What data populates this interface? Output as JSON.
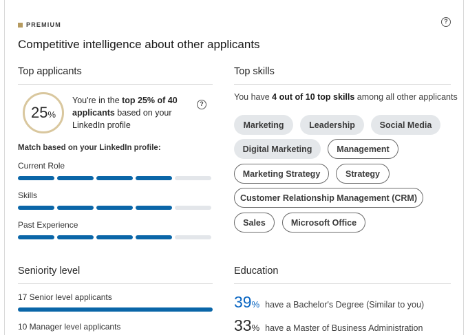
{
  "premium": {
    "label": "PREMIUM",
    "accent_color": "#b69b60"
  },
  "title": "Competitive intelligence about other applicants",
  "top_applicants": {
    "heading": "Top applicants",
    "percent_number": "25",
    "percent_sign": "%",
    "rank_prefix": "You're in the ",
    "rank_bold": "top 25% of 40 applicants",
    "rank_suffix": " based on your LinkedIn profile",
    "match_heading": "Match based on your LinkedIn profile:",
    "metrics": [
      {
        "label": "Current Role",
        "filled_segments": 4,
        "total_segments": 5
      },
      {
        "label": "Skills",
        "filled_segments": 4,
        "total_segments": 5
      },
      {
        "label": "Past Experience",
        "filled_segments": 4,
        "total_segments": 5
      }
    ],
    "bar_color": "#0a66a8"
  },
  "top_skills": {
    "heading": "Top skills",
    "intro_prefix": "You have ",
    "intro_bold": "4 out of 10 top skills",
    "intro_suffix": " among all other applicants",
    "skills": [
      {
        "label": "Marketing",
        "matched": true
      },
      {
        "label": "Leadership",
        "matched": true
      },
      {
        "label": "Social Media",
        "matched": true
      },
      {
        "label": "Digital Marketing",
        "matched": true
      },
      {
        "label": "Management",
        "matched": false
      },
      {
        "label": "Marketing Strategy",
        "matched": false
      },
      {
        "label": "Strategy",
        "matched": false
      },
      {
        "label": "Customer Relationship Management (CRM)",
        "matched": false
      },
      {
        "label": "Sales",
        "matched": false
      },
      {
        "label": "Microsoft Office",
        "matched": false
      }
    ]
  },
  "seniority": {
    "heading": "Seniority level",
    "items": [
      {
        "label": "17 Senior level applicants",
        "fraction": 1.0
      },
      {
        "label": "10 Manager level applicants"
      }
    ]
  },
  "education": {
    "heading": "Education",
    "items": [
      {
        "number": "39",
        "pct": "%",
        "text": "have a Bachelor's Degree (Similar to you)",
        "color": "#0a66c2"
      },
      {
        "number": "33",
        "pct": "%",
        "text": "have a Master of Business Administration",
        "color": "#2b2b2b"
      }
    ]
  },
  "icons": {
    "help": "help-circle-icon"
  }
}
